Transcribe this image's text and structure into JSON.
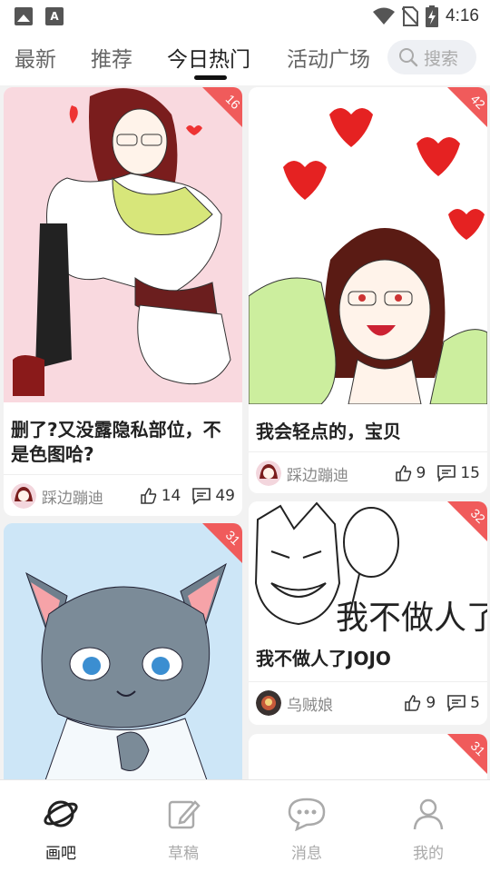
{
  "status_bar": {
    "time": "4:16",
    "left_icons": [
      "image-icon",
      "font-a-icon"
    ],
    "right_icons": [
      "wifi-icon",
      "no-sim-icon",
      "battery-charging-icon"
    ]
  },
  "tabs": [
    {
      "label": "最新",
      "active": false
    },
    {
      "label": "推荐",
      "active": false
    },
    {
      "label": "今日热门",
      "active": true
    },
    {
      "label": "活动广场",
      "active": false
    }
  ],
  "search": {
    "placeholder": "搜索",
    "icon": "search-icon"
  },
  "posts": [
    {
      "title": "删了?又没露隐私部位，不是色图哈?",
      "title_line1": "删了?又没露隐私部位，不",
      "title_line2": "是色图哈?",
      "author": "踩边蹦迪",
      "likes": "14",
      "comments": "49",
      "badge": "16"
    },
    {
      "title": "我会轻点的，宝贝",
      "author": "踩边蹦迪",
      "likes": "9",
      "comments": "15",
      "badge": "42"
    },
    {
      "title": "",
      "author": "",
      "likes": "",
      "comments": "",
      "badge": "31"
    },
    {
      "title": "我不做人了JOJO",
      "author": "乌贼娘",
      "likes": "9",
      "comments": "5",
      "badge": "32",
      "art_text": "我不做人了"
    },
    {
      "title": "",
      "author": "",
      "likes": "",
      "comments": "",
      "badge": "31"
    }
  ],
  "bottom_nav": [
    {
      "label": "画吧",
      "icon": "planet-icon",
      "active": true
    },
    {
      "label": "草稿",
      "icon": "edit-icon",
      "active": false
    },
    {
      "label": "消息",
      "icon": "chat-icon",
      "active": false
    },
    {
      "label": "我的",
      "icon": "person-icon",
      "active": false
    }
  ],
  "colors": {
    "accent": "#f05b5b",
    "active_text": "#222222",
    "inactive_text": "#aaaaaa",
    "background": "#f2f2f2"
  }
}
